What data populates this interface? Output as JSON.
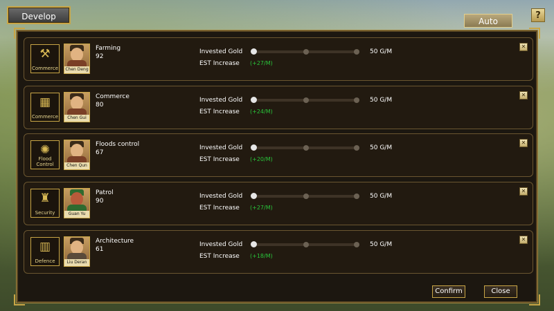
{
  "header": {
    "title": "Develop",
    "auto_label": "Auto",
    "help_label": "?"
  },
  "labels": {
    "invested_gold": "Invested Gold",
    "est_increase": "EST Increase"
  },
  "rows": [
    {
      "category_label": "Commerce",
      "icon": "sickle-icon",
      "glyph": "⚒",
      "officer": "Chen Deng",
      "title": "Farming",
      "value": "92",
      "gold": "50 G/M",
      "est": "(+27/M)",
      "invest_level": 0
    },
    {
      "category_label": "Commerce",
      "icon": "abacus-icon",
      "glyph": "▦",
      "officer": "Chen Gui",
      "title": "Commerce",
      "value": "80",
      "gold": "50 G/M",
      "est": "(+24/M)",
      "invest_level": 0
    },
    {
      "category_label": "Flood Control",
      "icon": "waterwheel-icon",
      "glyph": "✺",
      "officer": "Chen Qun",
      "title": "Floods control",
      "value": "67",
      "gold": "50 G/M",
      "est": "(+20/M)",
      "invest_level": 0
    },
    {
      "category_label": "Security",
      "icon": "soldiers-icon",
      "glyph": "♜",
      "officer": "Guan Yu",
      "title": "Patrol",
      "value": "90",
      "gold": "50 G/M",
      "est": "(+27/M)",
      "invest_level": 0
    },
    {
      "category_label": "Defence",
      "icon": "wall-icon",
      "glyph": "▥",
      "officer": "Liu Deran",
      "title": "Architecture",
      "value": "61",
      "gold": "50 G/M",
      "est": "(+18/M)",
      "invest_level": 0
    }
  ],
  "footer": {
    "confirm_label": "Confirm",
    "close_label": "Close"
  },
  "colors": {
    "accent": "#c9a646",
    "est_green": "#29c43a"
  }
}
